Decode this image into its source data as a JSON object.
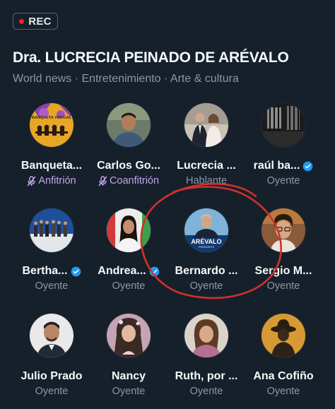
{
  "rec_label": "REC",
  "space_title": "Dra. LUCRECIA PEINADO DE ARÉVALO",
  "topics": "World news · Entretenimiento · Arte & cultura",
  "colors": {
    "background": "#15202b",
    "muted_text": "#8b98a5",
    "host_role": "#c7a3ea",
    "verified": "#1d9bf0",
    "rec_dot": "#f4212e",
    "annotation": "#d0322c"
  },
  "participants": [
    {
      "name": "Banqueta...",
      "role": "Anfitrión",
      "muted": true,
      "verified": false
    },
    {
      "name": "Carlos Go...",
      "role": "Coanfitrión",
      "muted": true,
      "verified": false
    },
    {
      "name": "Lucrecia ...",
      "role": "Hablante",
      "muted": false,
      "verified": false
    },
    {
      "name": "raúl ba...",
      "role": "Oyente",
      "muted": false,
      "verified": true
    },
    {
      "name": "Bertha...",
      "role": "Oyente",
      "muted": false,
      "verified": true
    },
    {
      "name": "Andrea...",
      "role": "Oyente",
      "muted": false,
      "verified": true
    },
    {
      "name": "Bernardo ...",
      "role": "Oyente",
      "muted": false,
      "verified": false
    },
    {
      "name": "Sergio M...",
      "role": "Oyente",
      "muted": false,
      "verified": false
    },
    {
      "name": "Julio Prado",
      "role": "Oyente",
      "muted": false,
      "verified": false
    },
    {
      "name": "Nancy",
      "role": "Oyente",
      "muted": false,
      "verified": false
    },
    {
      "name": "Ruth, por ...",
      "role": "Oyente",
      "muted": false,
      "verified": false
    },
    {
      "name": "Ana Cofiño",
      "role": "Oyente",
      "muted": false,
      "verified": false
    }
  ],
  "avatar_texts": {
    "banqueta_logo": "BANQUETA VIRTUAL",
    "arevalo_logo": "ARÉVALO",
    "arevalo_sub": "PRESIDENTE"
  }
}
